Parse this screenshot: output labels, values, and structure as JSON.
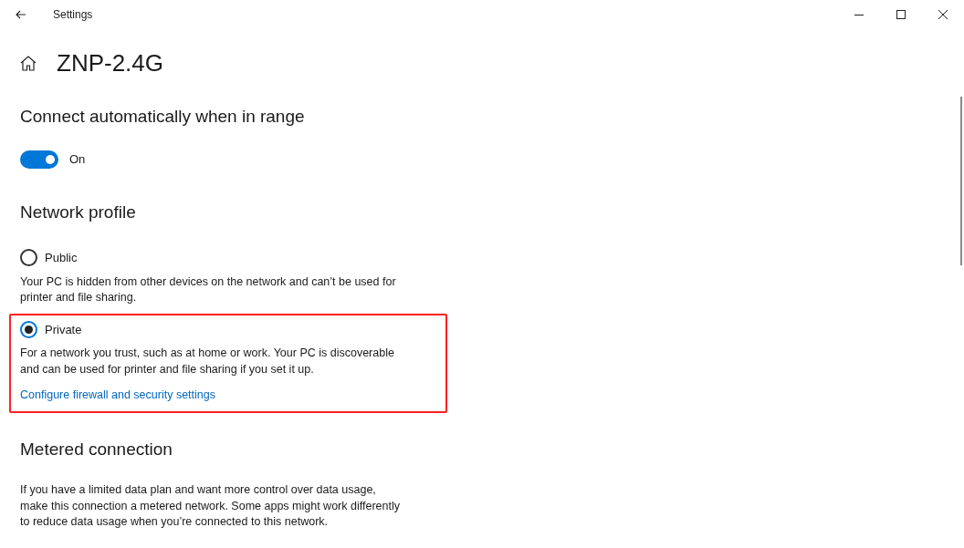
{
  "window": {
    "title": "Settings"
  },
  "page_title": "ZNP-2.4G",
  "connect_automatically": {
    "heading": "Connect automatically when in range",
    "on": true,
    "label": "On"
  },
  "network_profile": {
    "heading": "Network profile",
    "options": [
      {
        "label": "Public",
        "selected": false,
        "highlighted": false,
        "description": "Your PC is hidden from other devices on the network and can’t be used for printer and file sharing."
      },
      {
        "label": "Private",
        "selected": true,
        "highlighted": true,
        "description": "For a network you trust, such as at home or work. Your PC is discoverable and can be used for printer and file sharing if you set it up.",
        "link": "Configure firewall and security settings"
      }
    ]
  },
  "metered_connection": {
    "heading": "Metered connection",
    "description": "If you have a limited data plan and want more control over data usage, make this connection a metered network. Some apps might work differently to reduce data usage when you’re connected to this network."
  }
}
